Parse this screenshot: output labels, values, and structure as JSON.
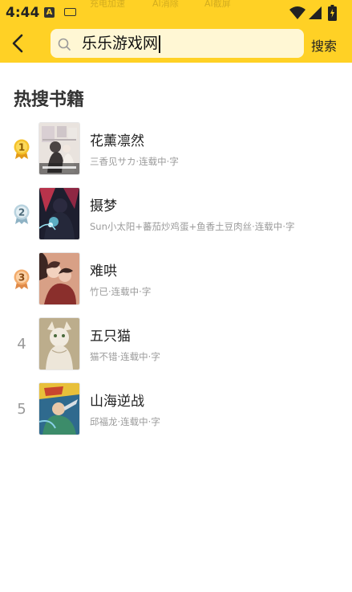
{
  "status_bar": {
    "time": "4:44",
    "notif_letter": "A",
    "ghost_items": [
      "充电加速",
      "AI消除",
      "AI截屏"
    ]
  },
  "header": {
    "search_query": "乐乐游戏网",
    "search_button": "搜索"
  },
  "section": {
    "title": "热搜书籍"
  },
  "books": [
    {
      "rank": "1",
      "title": "花薰凛然",
      "author": "三香见サカ",
      "status": "连载中",
      "words": "字",
      "medal": "gold"
    },
    {
      "rank": "2",
      "title": "摄梦",
      "author": "Sun小太阳+蕃茄炒鸡蛋+鱼香土豆肉丝",
      "status": "连载中",
      "words": "字",
      "medal": "silver"
    },
    {
      "rank": "3",
      "title": "难哄",
      "author": "竹已",
      "status": "连载中",
      "words": "字",
      "medal": "bronze"
    },
    {
      "rank": "4",
      "title": "五只猫",
      "author": "猫不错",
      "status": "连载中",
      "words": "字",
      "medal": "none"
    },
    {
      "rank": "5",
      "title": "山海逆战",
      "author": "邱福龙",
      "status": "连载中",
      "words": "字",
      "medal": "none"
    }
  ],
  "colors": {
    "header_bg": "#ffd125",
    "search_bg": "#fff7d4",
    "gold": "#f2b51c",
    "silver": "#a9c7d6",
    "bronze": "#f0a362"
  }
}
